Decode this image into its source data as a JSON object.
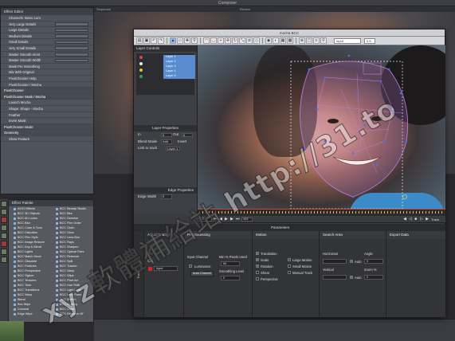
{
  "app": {
    "title": "Composer"
  },
  "viewers": {
    "left_label": "Sequence",
    "right_label": "Record"
  },
  "effect_editor": {
    "title": "Effect Editor",
    "rows": [
      {
        "label": "Channels: Manu Lum",
        "section": false
      },
      {
        "label": "Very Large Details",
        "section": false
      },
      {
        "label": "Large Details",
        "section": false
      },
      {
        "label": "Medium Details",
        "section": false
      },
      {
        "label": "Small Details",
        "section": false
      },
      {
        "label": "Very Small Details",
        "section": false
      },
      {
        "label": "Master Smooth Amnt",
        "section": false
      },
      {
        "label": "Master Smooth Width",
        "section": false
      },
      {
        "label": "Mask Pre Smoothing",
        "section": false
      },
      {
        "label": "Mix With Original",
        "section": false
      },
      {
        "label": "PixelChooser Help",
        "section": false
      },
      {
        "label": "PixelChooser / Mocha",
        "section": false
      },
      {
        "label": "PixelChooser",
        "section": true
      },
      {
        "label": "PixelChooser Mask / Mocha",
        "section": true
      },
      {
        "label": "Launch Mocha",
        "section": false
      },
      {
        "label": "Shape: Shape - Mocha",
        "section": false
      },
      {
        "label": "Feather",
        "section": false
      },
      {
        "label": "Invert Mask",
        "section": false
      },
      {
        "label": "PixelChooser Mode",
        "section": true
      },
      {
        "label": "Geometry",
        "section": true
      },
      {
        "label": "Show Feature",
        "section": false
      }
    ]
  },
  "bin": {
    "title": "Effect Palette",
    "col1": [
      "AVX2 Effects",
      "BCC 3D Objects",
      "BCC Art Looks",
      "BCC Blur",
      "BCC Color & Tone",
      "BCC Distortion",
      "BCC Film Style",
      "BCC Image Restore",
      "BCC Key & Blend",
      "BCC Lights",
      "BCC Match Move",
      "BCC Obsolete",
      "BCC Particles",
      "BCC Perspective",
      "BCC Stylize",
      "BCC Textures",
      "BCC Time",
      "BCC Transitions",
      "BCC Warp",
      "Blend",
      "Box Wipe",
      "Conceal",
      "Edge Wipe"
    ],
    "col2": [
      "BCC Beauty Studio",
      "BCC Blur",
      "BCC Denoise",
      "BCC Film Grain",
      "BCC Grain",
      "BCC Glow",
      "BCC Lens Blur",
      "BCC Rays",
      "BCC Sharpen",
      "BCC Optical Flare",
      "BCC Remover",
      "BCC Spill",
      "BCC Tracker",
      "BCC Warp",
      "BCC Wipe",
      "BCC Pixel Art",
      "BCC Hue Shift",
      "BCC Light Leak",
      "BCC Lens Flare",
      "BCC Motion",
      "BCC Overlay",
      "BCC Noise",
      "BCC Remover AT"
    ]
  },
  "mocha": {
    "title": "mocha BCC",
    "toolbar_icons": [
      "file-icon",
      "save-icon",
      "undo-icon",
      "redo-icon",
      "pointer-icon",
      "select-icon",
      "pan-icon",
      "zoom-icon",
      "xspline-icon",
      "bezier-icon",
      "add-point-icon",
      "move-icon",
      "rotate-icon",
      "scale-icon",
      "shear-icon",
      "perspective-icon",
      "view-icon",
      "overlay-icon",
      "grid-icon",
      "matte-icon",
      "track-icon",
      "surface-icon",
      "stabilize-icon",
      "zoom-window-icon"
    ],
    "toolbar_glyphs": [
      "▤",
      "▣",
      "↶",
      "↷",
      "▲",
      "▭",
      "✥",
      "⚲",
      "◠",
      "◡",
      "+",
      "✣",
      "↻",
      "⤡",
      "⧄",
      "◇",
      "◉",
      "◐",
      "▦",
      "▩",
      "⊕",
      "▢",
      "≡",
      "⚲"
    ],
    "view_input": "Input",
    "zoom": "0.5",
    "layer_controls_title": "Layer Controls",
    "layers": [
      "Layer 1",
      "Layer 2",
      "Layer 3",
      "Layer 4",
      "Layer 5"
    ],
    "layer_properties": {
      "title": "Layer Properties",
      "in_label": "In",
      "in_value": "0",
      "out_label": "Out",
      "out_value": "0",
      "blend_label": "Blend Mode",
      "blend_value": "Add",
      "invert_label": "Invert",
      "link_label": "Link to track",
      "link_value": "Layer 1",
      "edge_title": "Edge Properties",
      "edge_width": "Edge Width",
      "edge_value": "0"
    },
    "transport": {
      "frame": "0",
      "end_frame": "103",
      "track_label": "Track"
    },
    "params": {
      "title": "Parameters",
      "vtabs": [
        "Track",
        "Adjust Track",
        "Camera Solve"
      ],
      "clip_header": "Clip",
      "clip_value": "Input",
      "adjust_header": "Adjust Track",
      "preprocessing_header": "Preprocessing",
      "input_channel": "Input Channel",
      "luminance": "Luminance",
      "auto_channel": "Auto Channel",
      "min_pixels": "Min % Pixels Used",
      "min_value": "60",
      "smoothing": "Smoothing Level",
      "smoothing_value": "0",
      "motion_header": "Motion",
      "motion_items": [
        "Translation",
        "Scale",
        "Rotation",
        "Shear",
        "Perspective"
      ],
      "motion_checked": [
        true,
        true,
        true,
        false,
        false
      ],
      "large_motion": "Large Motion",
      "small_motion": "Small Motion",
      "manual_track": "Manual Track",
      "search_header": "Search Area",
      "horizontal": "Horizontal",
      "vertical": "Vertical",
      "auto": "Auto",
      "export_header": "Export Data",
      "angle": "Angle",
      "zoom_label": "Zoom %",
      "angle_value": "0",
      "zoom_value": "0"
    }
  },
  "watermark": "xyz軟體補給站 http://31.to",
  "colors": {
    "accent_blue": "#5a8cd2",
    "spline_color": "#c77fe0",
    "timeline_red": "#cc4433"
  }
}
